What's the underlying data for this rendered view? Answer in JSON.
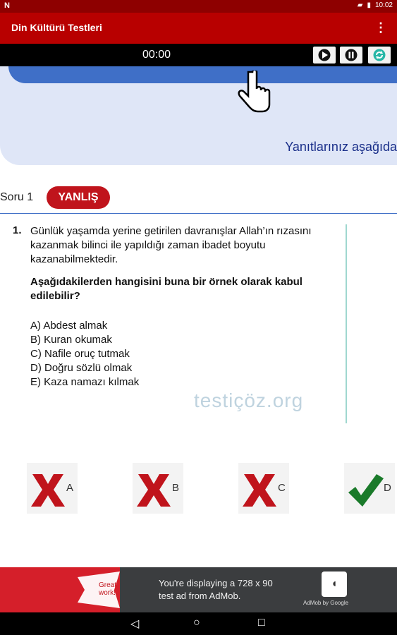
{
  "status_bar": {
    "left": "N",
    "time": "10:02"
  },
  "app": {
    "title": "Din Kültürü Testleri",
    "menu_icon": "more-vert-icon"
  },
  "timer": {
    "value": "00:00"
  },
  "controls": {
    "icons": [
      "play-icon",
      "pause-icon",
      "refresh-icon"
    ]
  },
  "banner": {
    "hint": "Yanıtlarınız aşağıda"
  },
  "question": {
    "label": "Soru 1",
    "result_badge": "YANLIŞ",
    "number": "1.",
    "text": "Günlük yaşamda yerine getirilen davranışlar Allah’ın rızasını kazanmak bilinci ile yapıldığı zaman ibadet boyutu kazanabilmektedir.",
    "prompt": "Aşağıdakilerden hangisini buna bir örnek olarak kabul edilebilir?",
    "options": [
      "A) Abdest almak",
      "B) Kuran okumak",
      "C) Nafile oruç tutmak",
      "D) Doğru sözlü olmak",
      "E) Kaza namazı kılmak"
    ],
    "watermark": "testiçöz.org"
  },
  "answers": [
    {
      "letter": "A",
      "mark": "cross"
    },
    {
      "letter": "B",
      "mark": "cross"
    },
    {
      "letter": "C",
      "mark": "cross"
    },
    {
      "letter": "D",
      "mark": "check"
    }
  ],
  "ad": {
    "left_text": "Great work!",
    "line1": "You're displaying a 728 x 90",
    "line2": "test ad from AdMob.",
    "brand": "AdMob by Google"
  },
  "colors": {
    "status": "#8e0000",
    "appbar": "#b80000",
    "badge": "#c0141c",
    "accent": "#3f6fc7"
  }
}
